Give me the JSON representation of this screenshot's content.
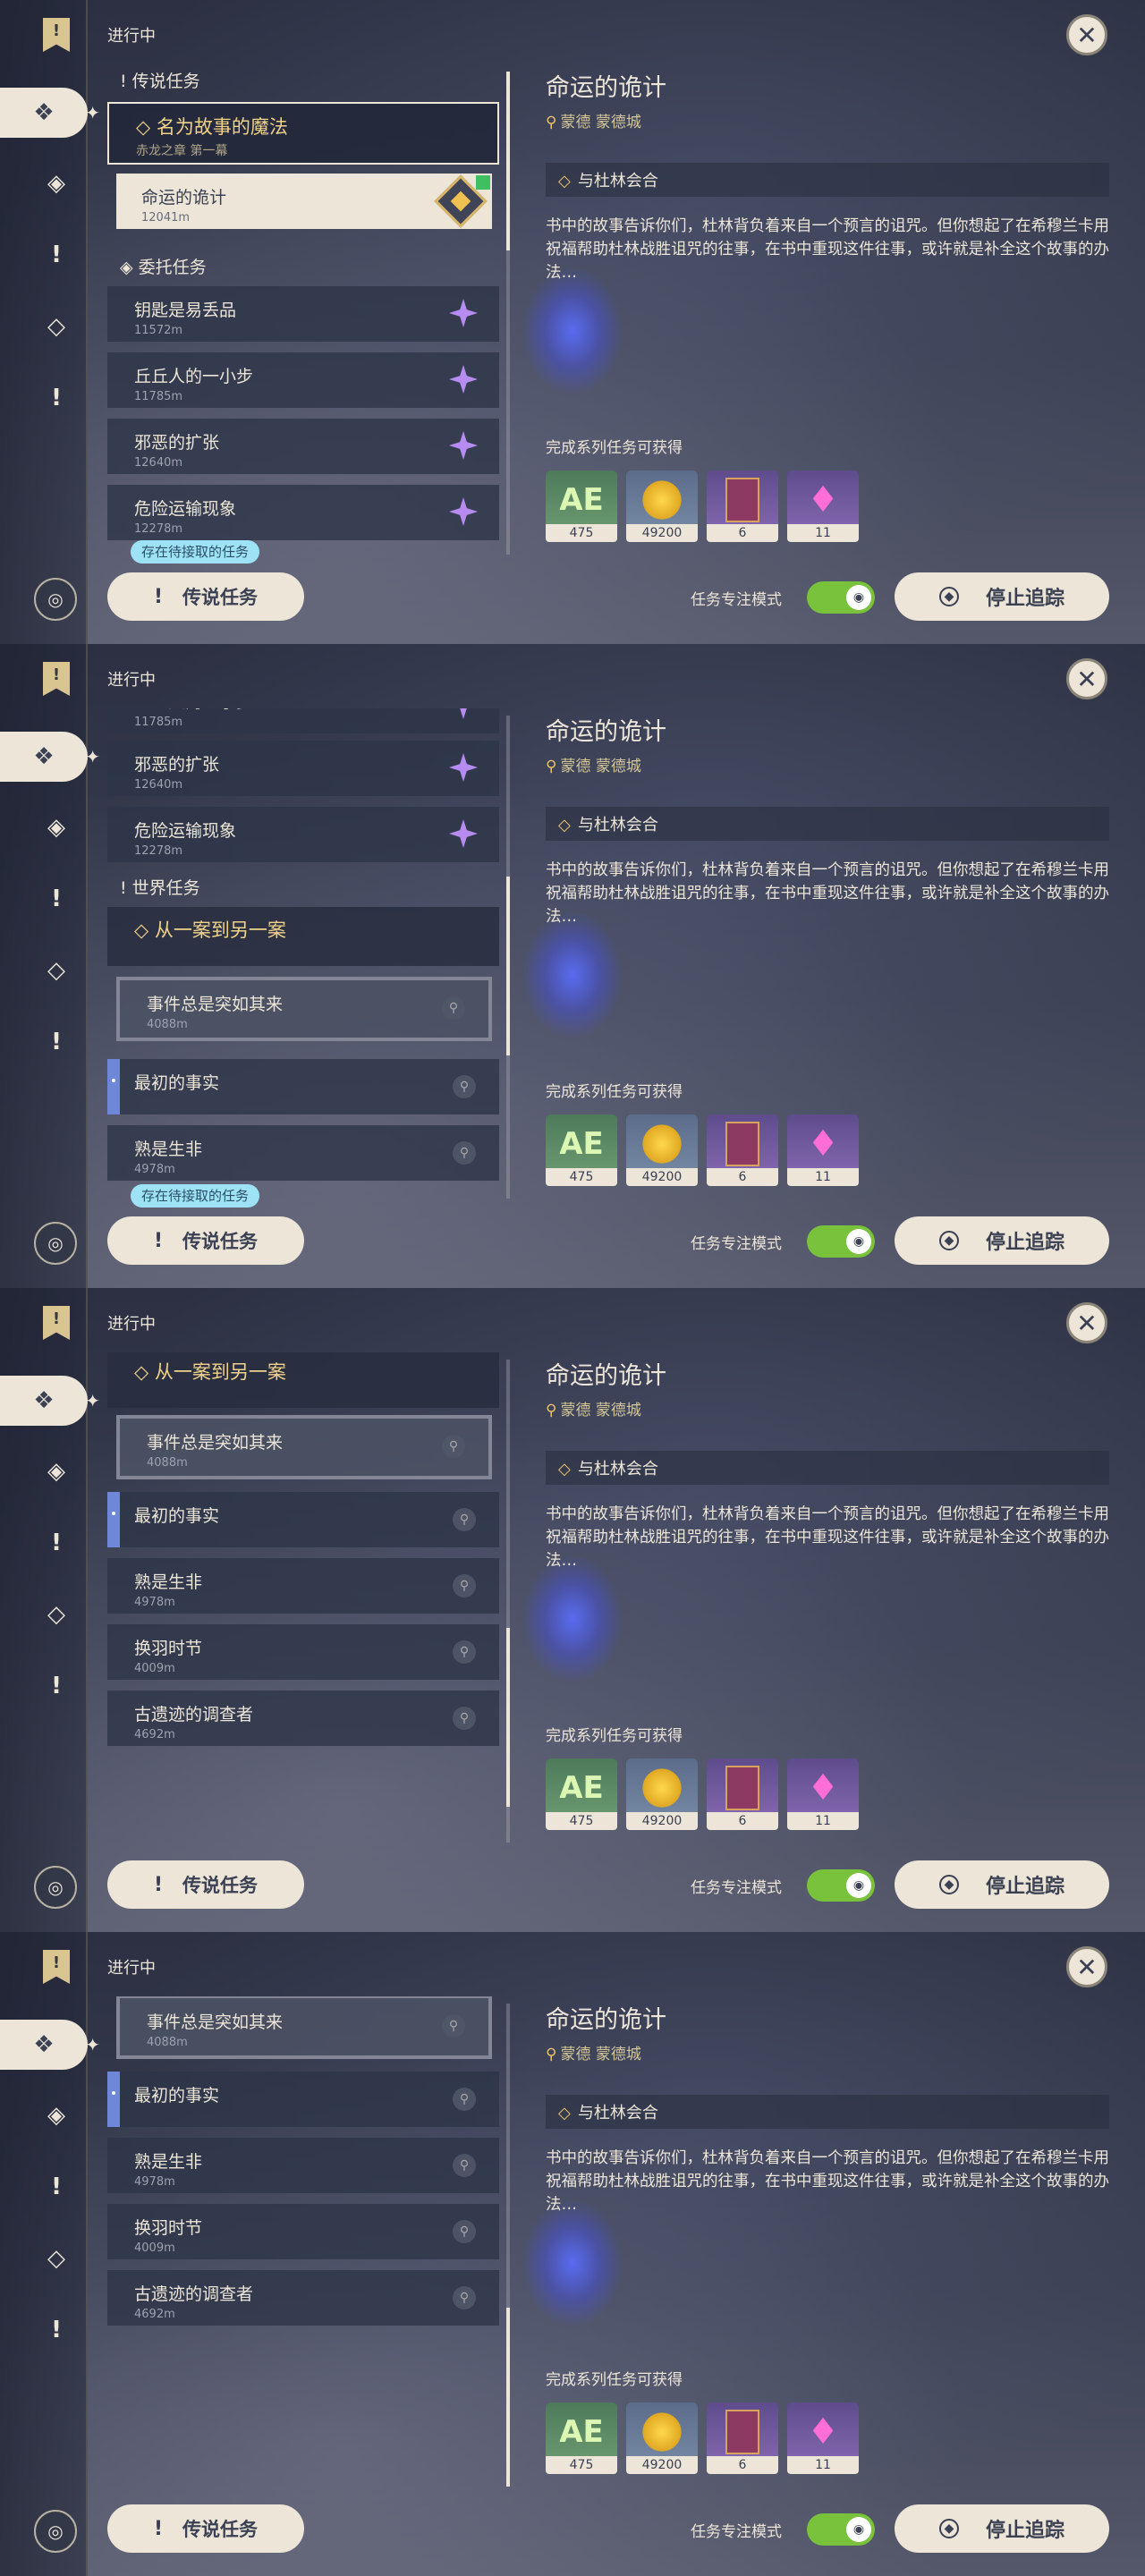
{
  "header": {
    "in_progress": "进行中",
    "close": "✕"
  },
  "rail": {
    "bookmark_glyph": "!"
  },
  "detail": {
    "title": "命运的诡计",
    "location": "蒙德 蒙德城",
    "step": "与杜林会合",
    "description": "书中的故事告诉你们，杜林背负着来自一个预言的诅咒。但你想起了在希穆兰卡用祝福帮助杜林战胜诅咒的往事，在书中重现这件往事，或许就是补全这个故事的办法…",
    "reward_label": "完成系列任务可获得",
    "rewards": [
      {
        "icon": "adventure-exp-icon",
        "glyph": "AE",
        "count": "475"
      },
      {
        "icon": "mora-icon",
        "glyph": "",
        "count": "49200"
      },
      {
        "icon": "heros-wit-book-icon",
        "glyph": "",
        "count": "6"
      },
      {
        "icon": "crystal-icon",
        "glyph": "♦",
        "count": "11"
      }
    ]
  },
  "footer": {
    "pending": "存在待接取的任务",
    "legend_button": "传说任务",
    "focus_label": "任务专注模式",
    "stop_tracking": "停止追踪"
  },
  "list": {
    "legend_section": "传说任务",
    "commission_section": "委托任务",
    "world_section": "世界任务",
    "legend_chain": {
      "title": "名为故事的魔法",
      "subtitle": "赤龙之章 第一幕"
    },
    "legend_sub": {
      "title": "命运的诡计",
      "dist": "12041m"
    },
    "commissions": [
      {
        "title": "钥匙是易丢品",
        "dist": "11572m"
      },
      {
        "title": "丘丘人的一小步",
        "dist": "11785m"
      },
      {
        "title": "邪恶的扩张",
        "dist": "12640m"
      },
      {
        "title": "危险运输现象",
        "dist": "12278m"
      }
    ],
    "world_chain": {
      "title": "从一案到另一案"
    },
    "world_items": [
      {
        "title": "事件总是突如其来",
        "dist": "4088m"
      },
      {
        "title": "最初的事实",
        "dist": ""
      },
      {
        "title": "熟是生非",
        "dist": "4978m"
      },
      {
        "title": "换羽时节",
        "dist": "4009m"
      },
      {
        "title": "古遗迹的调查者",
        "dist": "4692m"
      }
    ]
  },
  "colors": {
    "accent_gold": "#f1d28a",
    "toggle_green": "#79c23b",
    "pending_cyan": "#9ee2f6",
    "selected_blue": "#6f87d8"
  }
}
